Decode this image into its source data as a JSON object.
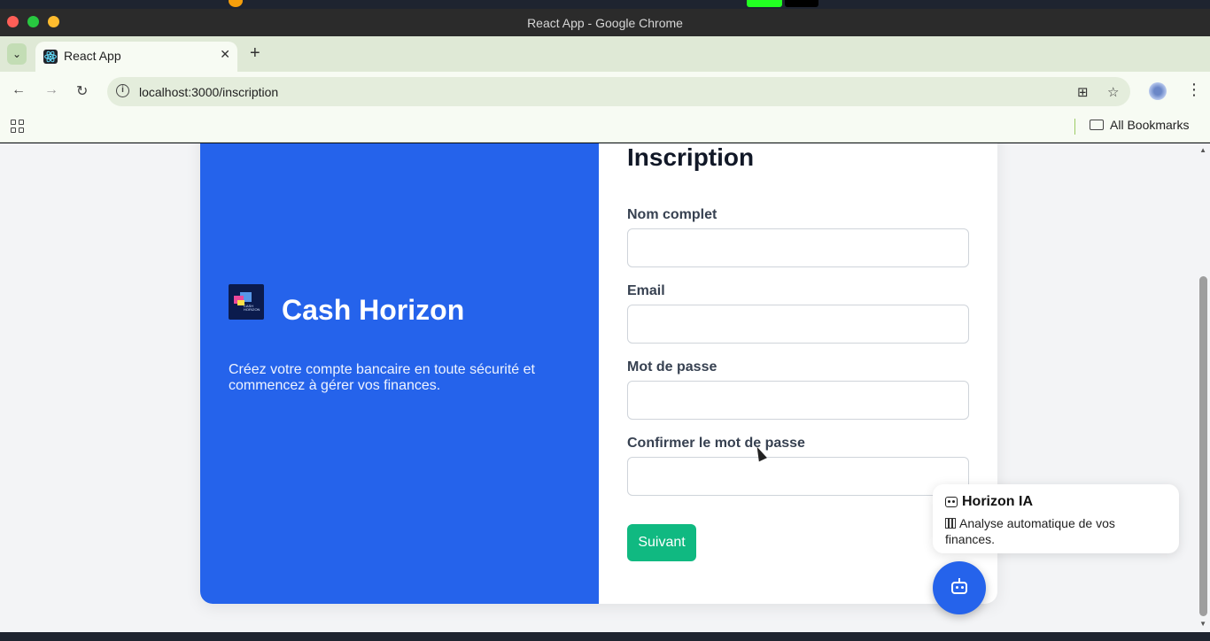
{
  "window": {
    "title": "React App - Google Chrome"
  },
  "tabs": [
    {
      "label": "React App",
      "active": true
    }
  ],
  "address_bar": {
    "url": "localhost:3000/inscription"
  },
  "bookmarks_bar": {
    "all_bookmarks_label": "All Bookmarks"
  },
  "brand": {
    "name": "Cash Horizon",
    "tagline": "Créez votre compte bancaire en toute sécurité et commencez à gérer vos finances.",
    "logo_text": "CASH HORIZON"
  },
  "form": {
    "title": "Inscription",
    "fields": [
      {
        "label": "Nom complet",
        "value": ""
      },
      {
        "label": "Email",
        "value": ""
      },
      {
        "label": "Mot de passe",
        "value": ""
      },
      {
        "label": "Confirmer le mot de passe",
        "value": ""
      }
    ],
    "submit_label": "Suivant"
  },
  "assistant": {
    "title": "Horizon IA",
    "message": "Analyse automatique de vos finances."
  },
  "colors": {
    "brand_blue": "#2563eb",
    "submit_green": "#10b981",
    "page_bg": "#f3f4f6"
  }
}
